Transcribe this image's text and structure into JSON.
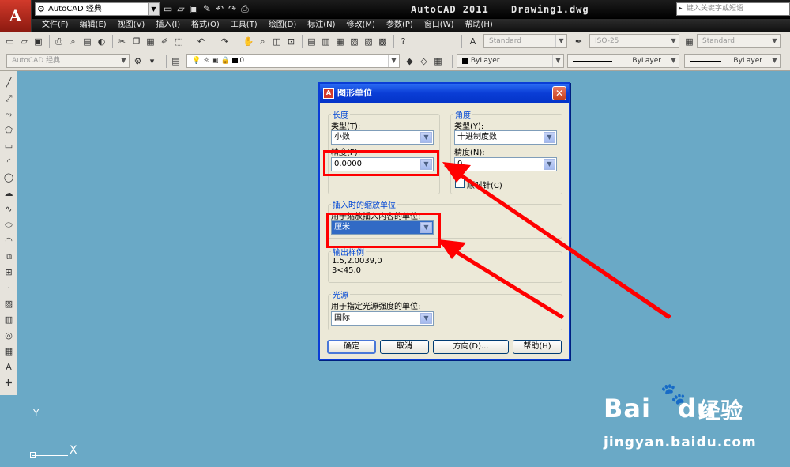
{
  "titlebar": {
    "app_logo": "A",
    "workspace": "AutoCAD 经典",
    "app_title": "AutoCAD 2011",
    "file_name": "Drawing1.dwg",
    "search_placeholder": "键入关键字或短语"
  },
  "menu": [
    "文件(F)",
    "编辑(E)",
    "视图(V)",
    "插入(I)",
    "格式(O)",
    "工具(T)",
    "绘图(D)",
    "标注(N)",
    "修改(M)",
    "参数(P)",
    "窗口(W)",
    "帮助(H)"
  ],
  "toolbar1": {
    "text_style": "Standard",
    "dim_style": "ISO-25",
    "table_style": "Standard"
  },
  "toolbar2": {
    "workspace": "AutoCAD 经典",
    "layer": "0",
    "color": "ByLayer",
    "linetype": "ByLayer",
    "lineweight": "ByLayer"
  },
  "ucs": {
    "y_label": "Y",
    "x_label": "X"
  },
  "watermark": {
    "logo_text": "Bai",
    "logo_suffix": "du",
    "cn_text": "经验",
    "url": "jingyan.baidu.com"
  },
  "dialog": {
    "title": "图形单位",
    "close_label": "✕",
    "length": {
      "group_label": "长度",
      "type_label": "类型(T):",
      "type_value": "小数",
      "precision_label": "精度(P):",
      "precision_value": "0.0000"
    },
    "angle": {
      "group_label": "角度",
      "type_label": "类型(Y):",
      "type_value": "十进制度数",
      "precision_label": "精度(N):",
      "precision_value": "0",
      "clockwise_label": "顺时针(C)",
      "clockwise_checked": false
    },
    "insertion": {
      "group_label": "插入时的缩放单位",
      "field_label": "用于缩放插入内容的单位:",
      "value": "厘米"
    },
    "sample": {
      "group_label": "输出样例",
      "line1": "1.5,2.0039,0",
      "line2": "3<45,0"
    },
    "lighting": {
      "group_label": "光源",
      "field_label": "用于指定光源强度的单位:",
      "value": "国际"
    },
    "buttons": {
      "ok": "确定",
      "cancel": "取消",
      "direction": "方向(D)...",
      "help": "帮助(H)"
    }
  },
  "colors": {
    "canvas": "#6aa9c6",
    "dialog_title": "#0a3dd6",
    "highlight": "#ff0000",
    "selection": "#316ac5"
  }
}
